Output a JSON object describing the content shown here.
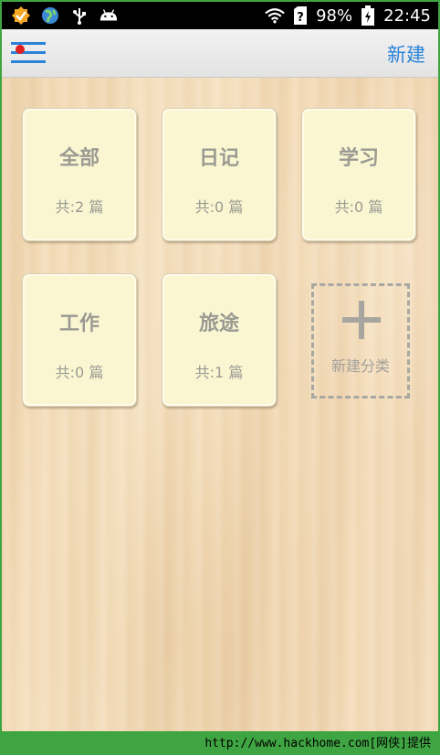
{
  "status_bar": {
    "battery": "98%",
    "time": "22:45",
    "icons": [
      "notification-badge-icon",
      "globe-icon",
      "usb-icon",
      "android-icon",
      "wifi-icon",
      "sim-unknown-icon",
      "battery-charging-icon"
    ]
  },
  "header": {
    "menu_icon": "list-menu-icon",
    "new_label": "新建"
  },
  "categories": [
    {
      "name": "全部",
      "count": "共:2 篇"
    },
    {
      "name": "日记",
      "count": "共:0 篇"
    },
    {
      "name": "学习",
      "count": "共:0 篇"
    },
    {
      "name": "工作",
      "count": "共:0 篇"
    },
    {
      "name": "旅途",
      "count": "共:1 篇"
    }
  ],
  "add_category": {
    "label": "新建分类",
    "icon": "plus-icon"
  },
  "footer": {
    "text": "http://www.hackhome.com[网侠]提供"
  },
  "colors": {
    "accent": "#2a83d8",
    "frame_green": "#3fa542",
    "card_bg": "#faf6d2",
    "card_text": "#9a9a92"
  }
}
